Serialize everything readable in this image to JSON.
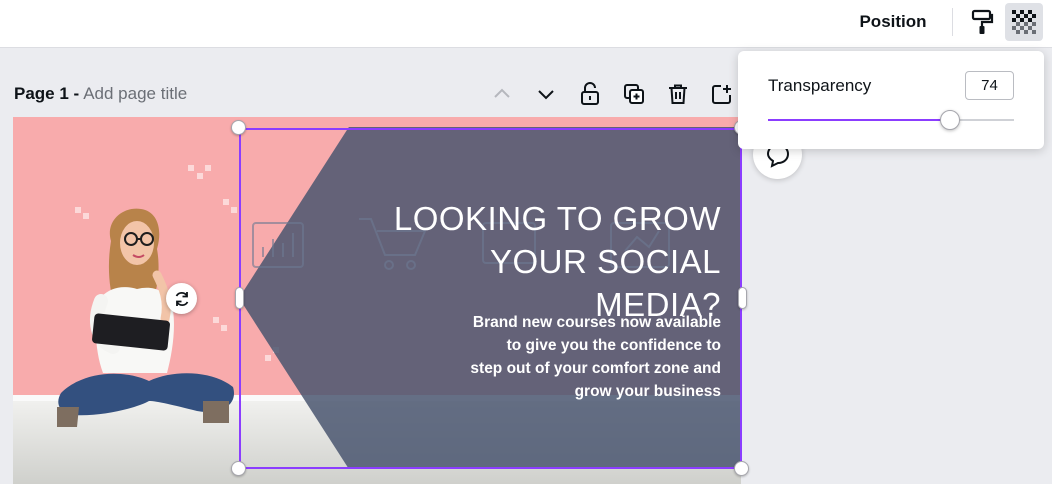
{
  "toolbar": {
    "position_label": "Position",
    "paint_icon": "paint-roller-icon",
    "transparency_icon": "checkerboard-icon"
  },
  "page": {
    "label": "Page 1 -",
    "title_placeholder": "Add page title",
    "tools": [
      "chevron-up-icon",
      "chevron-down-icon",
      "unlock-icon",
      "duplicate-icon",
      "trash-icon",
      "add-page-icon"
    ]
  },
  "design": {
    "headline": "LOOKING TO GROW\nYOUR SOCIAL MEDIA?",
    "subtext": "Brand new courses now available\nto give you  the confidence to\nstep out of your comfort zone and\ngrow your business",
    "colors": {
      "background": "#f8abac",
      "overlay": "#47546e",
      "selection": "#8b3dff"
    }
  },
  "transparency_panel": {
    "label": "Transparency",
    "value": "74",
    "level": 0.74
  }
}
